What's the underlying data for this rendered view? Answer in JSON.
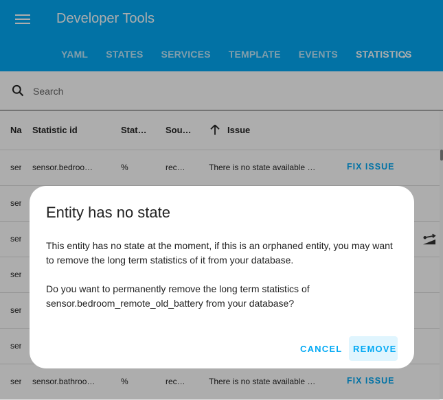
{
  "header": {
    "title": "Developer Tools",
    "menu_icon": "hamburger-menu-icon",
    "tabs": [
      {
        "label": "YAML",
        "active": false
      },
      {
        "label": "STATES",
        "active": false
      },
      {
        "label": "SERVICES",
        "active": false
      },
      {
        "label": "TEMPLATE",
        "active": false
      },
      {
        "label": "EVENTS",
        "active": false
      },
      {
        "label": "STATISTICS",
        "active": true
      }
    ],
    "next_icon": "chevron-right-icon",
    "accent_color": "#03a9f4"
  },
  "search": {
    "placeholder": "Search",
    "value": "",
    "icon": "search-icon"
  },
  "table": {
    "columns": [
      "Name",
      "Statistic id",
      "Statistics unit",
      "Source",
      "Issue"
    ],
    "columns_display": [
      "Na",
      "Statistic id",
      "Stat…",
      "Sou…",
      "Issue"
    ],
    "sort": {
      "column": "Issue",
      "direction": "ascending",
      "icon": "arrow-up-icon"
    },
    "rows": [
      {
        "name": "ser",
        "statistic_id": "sensor.bedroo…",
        "unit": "%",
        "source": "rec…",
        "issue": "There is no state available …",
        "action": "FIX ISSUE"
      },
      {
        "name": "ser",
        "statistic_id": "",
        "unit": "",
        "source": "",
        "issue": "",
        "action": ""
      },
      {
        "name": "ser",
        "statistic_id": "",
        "unit": "",
        "source": "",
        "issue": "",
        "action": "",
        "icon": "unit-change-icon"
      },
      {
        "name": "ser",
        "statistic_id": "",
        "unit": "",
        "source": "",
        "issue": "",
        "action": ""
      },
      {
        "name": "ser",
        "statistic_id": "",
        "unit": "",
        "source": "",
        "issue": "",
        "action": ""
      },
      {
        "name": "ser",
        "statistic_id": "",
        "unit": "",
        "source": "",
        "issue": "",
        "action": ""
      },
      {
        "name": "ser",
        "statistic_id": "sensor.bathroo…",
        "unit": "%",
        "source": "rec…",
        "issue": "There is no state available …",
        "action": "FIX ISSUE"
      }
    ]
  },
  "dialog": {
    "title": "Entity has no state",
    "paragraph1": "This entity has no state at the moment, if this is an orphaned entity, you may want to remove the long term statistics of it from your database.",
    "paragraph2": "Do you want to permanently remove the long term statistics of sensor.bedroom_remote_old_battery from your database?",
    "cancel_label": "CANCEL",
    "remove_label": "REMOVE"
  }
}
